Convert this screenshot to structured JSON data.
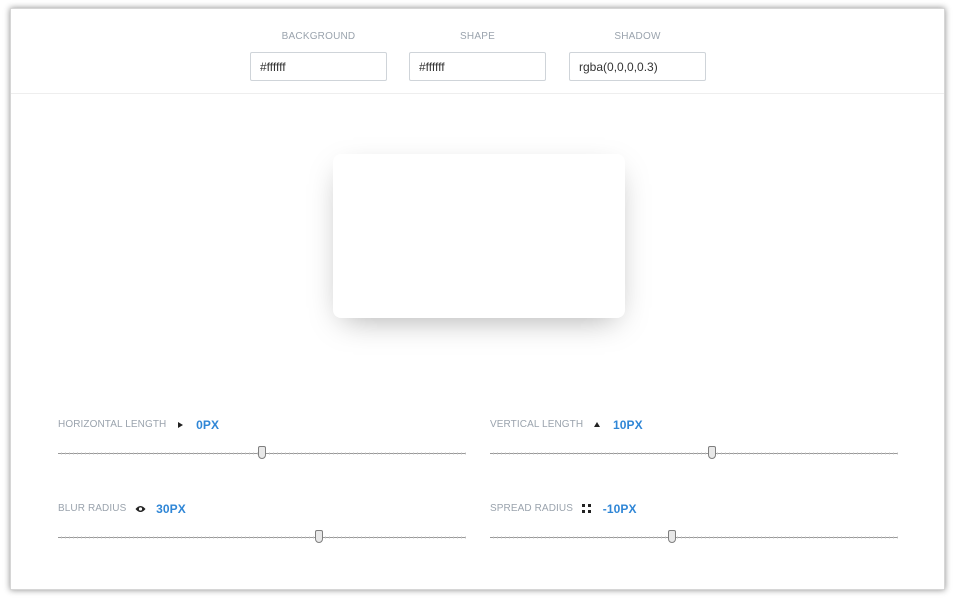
{
  "toolbar": {
    "background": {
      "label": "BACKGROUND",
      "value": "#ffffff"
    },
    "shape": {
      "label": "SHAPE",
      "value": "#ffffff"
    },
    "shadow": {
      "label": "SHADOW",
      "value": "rgba(0,0,0,0.3)"
    }
  },
  "preview": {
    "background_color": "#ffffff",
    "shape_color": "#ffffff",
    "shadow_color": "rgba(0,0,0,0.3)"
  },
  "controls": {
    "horizontal": {
      "label": "HORIZONTAL LENGTH",
      "icon": "arrow-right-icon",
      "value": "0PX",
      "level": 0.5
    },
    "vertical": {
      "label": "VERTICAL LENGTH",
      "icon": "arrow-up-icon",
      "value": "10PX",
      "level": 0.545
    },
    "blur": {
      "label": "BLUR RADIUS",
      "icon": "eye-icon",
      "value": "30PX",
      "level": 0.64
    },
    "spread": {
      "label": "SPREAD RADIUS",
      "icon": "spread-dots-icon",
      "value": "-10PX",
      "level": 0.445
    }
  },
  "colors": {
    "accent": "#2f86d6",
    "label": "#9aa3ad"
  }
}
